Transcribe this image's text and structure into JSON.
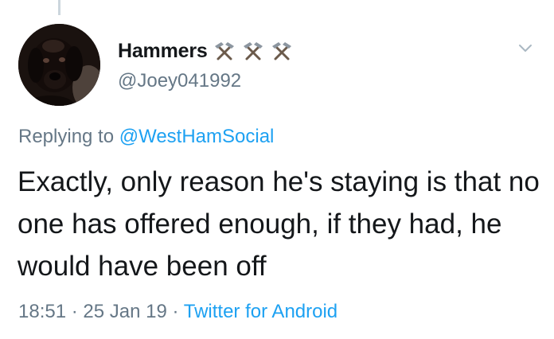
{
  "colors": {
    "text_primary": "#14171a",
    "text_secondary": "#657786",
    "link": "#1da1f2",
    "thread_line": "#ccd6dd"
  },
  "tweet": {
    "author": {
      "display_name": "Hammers",
      "name_emoji": [
        "hammer-pick-icon",
        "hammer-pick-icon",
        "hammer-pick-icon"
      ],
      "handle": "@Joey041992",
      "avatar": "dog-avatar"
    },
    "reply": {
      "prefix": "Replying to",
      "to_handle": "@WestHamSocial"
    },
    "text": "Exactly, only reason he's staying is that no one has offered enough, if they had, he would have been off",
    "time": "18:51",
    "separator": "·",
    "date": "25 Jan 19",
    "source": "Twitter for Android",
    "menu_icon": "chevron-down-icon"
  }
}
